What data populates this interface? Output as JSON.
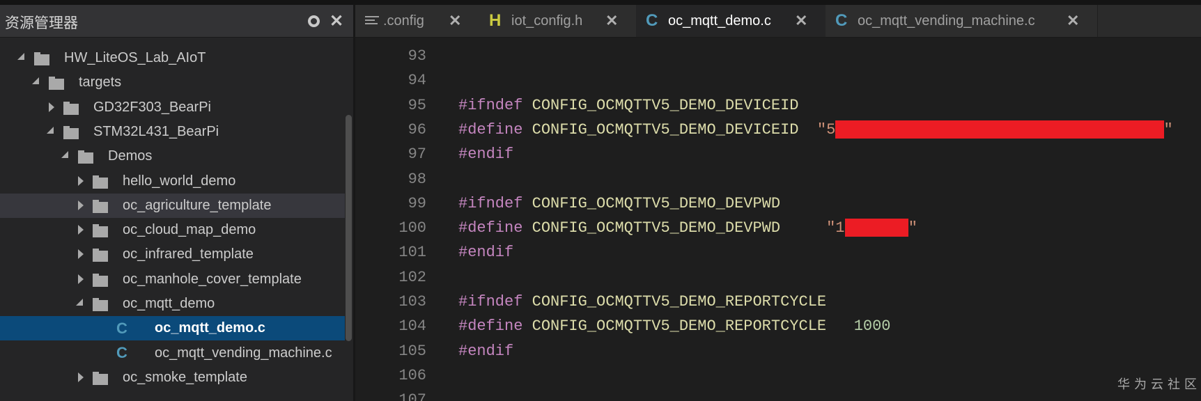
{
  "sidebar": {
    "title": "资源管理器",
    "collapse_icon": "collapse-all-icon",
    "close_icon": "close-icon",
    "tree": [
      {
        "label": "HW_LiteOS_Lab_AIoT",
        "type": "folder",
        "depth": 0,
        "expanded": true
      },
      {
        "label": "targets",
        "type": "folder",
        "depth": 1,
        "expanded": true
      },
      {
        "label": "GD32F303_BearPi",
        "type": "folder",
        "depth": 2,
        "expanded": false
      },
      {
        "label": "STM32L431_BearPi",
        "type": "folder",
        "depth": 2,
        "expanded": true
      },
      {
        "label": "Demos",
        "type": "folder",
        "depth": 3,
        "expanded": true
      },
      {
        "label": "hello_world_demo",
        "type": "folder",
        "depth": 4,
        "expanded": false
      },
      {
        "label": "oc_agriculture_template",
        "type": "folder",
        "depth": 4,
        "expanded": false,
        "hover": true
      },
      {
        "label": "oc_cloud_map_demo",
        "type": "folder",
        "depth": 4,
        "expanded": false
      },
      {
        "label": "oc_infrared_template",
        "type": "folder",
        "depth": 4,
        "expanded": false
      },
      {
        "label": "oc_manhole_cover_template",
        "type": "folder",
        "depth": 4,
        "expanded": false
      },
      {
        "label": "oc_mqtt_demo",
        "type": "folder",
        "depth": 4,
        "expanded": true
      },
      {
        "label": "oc_mqtt_demo.c",
        "type": "c-file",
        "depth": 5,
        "selected": true
      },
      {
        "label": "oc_mqtt_vending_machine.c",
        "type": "c-file",
        "depth": 5
      },
      {
        "label": "oc_smoke_template",
        "type": "folder",
        "depth": 4,
        "expanded": false
      }
    ]
  },
  "tabs": [
    {
      "label": ".config",
      "icon": "text-file-icon",
      "icon_text": "",
      "active": false
    },
    {
      "label": "iot_config.h",
      "icon": "header-file-icon",
      "icon_text": "H",
      "icon_color": "#cbcb41",
      "active": false
    },
    {
      "label": "oc_mqtt_demo.c",
      "icon": "c-file-icon",
      "icon_text": "C",
      "icon_color": "#519aba",
      "active": true
    },
    {
      "label": "oc_mqtt_vending_machine.c",
      "icon": "c-file-icon",
      "icon_text": "C",
      "icon_color": "#519aba",
      "active": false
    }
  ],
  "tab_close_glyph": "✕",
  "editor": {
    "lines": [
      {
        "n": "93",
        "tokens": []
      },
      {
        "n": "94",
        "tokens": []
      },
      {
        "n": "95",
        "tokens": [
          {
            "t": "#ifndef",
            "c": "kw"
          },
          {
            "t": " "
          },
          {
            "t": "CONFIG_OCMQTTV5_DEMO_DEVICEID",
            "c": "mac"
          }
        ]
      },
      {
        "n": "96",
        "tokens": [
          {
            "t": "#define",
            "c": "kw"
          },
          {
            "t": " "
          },
          {
            "t": "CONFIG_OCMQTTV5_DEMO_DEVICEID",
            "c": "mac"
          },
          {
            "t": "  "
          },
          {
            "t": "\"5",
            "c": "str"
          },
          {
            "redact": 31
          },
          {
            "t": "\"",
            "c": "str"
          }
        ]
      },
      {
        "n": "97",
        "tokens": [
          {
            "t": "#endif",
            "c": "kw"
          }
        ]
      },
      {
        "n": "98",
        "tokens": []
      },
      {
        "n": "99",
        "tokens": [
          {
            "t": "#ifndef",
            "c": "kw"
          },
          {
            "t": " "
          },
          {
            "t": "CONFIG_OCMQTTV5_DEMO_DEVPWD",
            "c": "mac"
          }
        ]
      },
      {
        "n": "100",
        "tokens": [
          {
            "t": "#define",
            "c": "kw"
          },
          {
            "t": " "
          },
          {
            "t": "CONFIG_OCMQTTV5_DEMO_DEVPWD",
            "c": "mac"
          },
          {
            "t": "     "
          },
          {
            "t": "\"1",
            "c": "str"
          },
          {
            "redact": 6
          },
          {
            "t": "\"",
            "c": "str"
          }
        ]
      },
      {
        "n": "101",
        "tokens": [
          {
            "t": "#endif",
            "c": "kw"
          }
        ]
      },
      {
        "n": "102",
        "tokens": []
      },
      {
        "n": "103",
        "tokens": [
          {
            "t": "#ifndef",
            "c": "kw"
          },
          {
            "t": " "
          },
          {
            "t": "CONFIG_OCMQTTV5_DEMO_REPORTCYCLE",
            "c": "mac"
          }
        ]
      },
      {
        "n": "104",
        "tokens": [
          {
            "t": "#define",
            "c": "kw"
          },
          {
            "t": " "
          },
          {
            "t": "CONFIG_OCMQTTV5_DEMO_REPORTCYCLE",
            "c": "mac"
          },
          {
            "t": "   "
          },
          {
            "t": "1000",
            "c": "num"
          }
        ]
      },
      {
        "n": "105",
        "tokens": [
          {
            "t": "#endif",
            "c": "kw"
          }
        ]
      },
      {
        "n": "106",
        "tokens": []
      },
      {
        "n": "107",
        "tokens": []
      }
    ]
  },
  "watermark": "华为云社区",
  "colors": {
    "selection": "#0b4a7a",
    "keyword": "#c586c0",
    "macro": "#dcdcaa",
    "number": "#b5cea8",
    "redaction": "#ec1c24"
  }
}
